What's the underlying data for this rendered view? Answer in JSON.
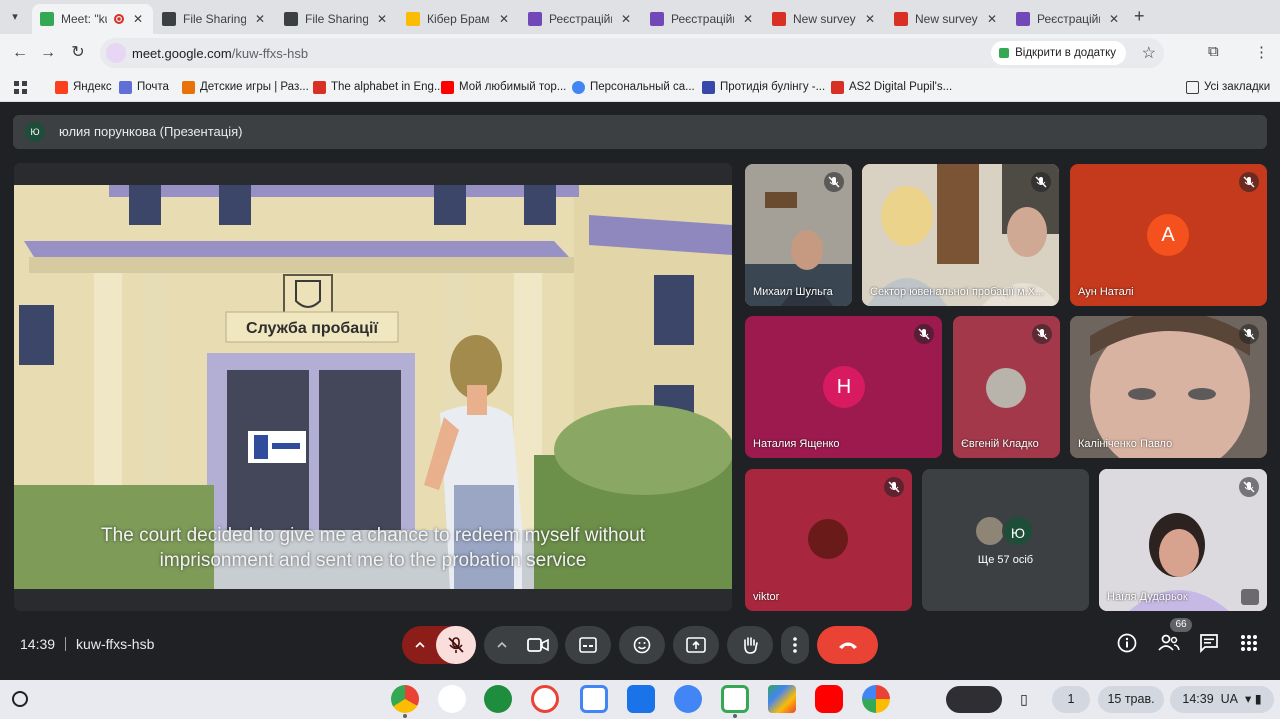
{
  "browser": {
    "tabs": [
      {
        "label": "Meet: \"ku",
        "favicon_color": "#34a853",
        "active": true
      },
      {
        "label": "File Sharing a",
        "favicon_color": "#3c4043"
      },
      {
        "label": "File Sharing a",
        "favicon_color": "#3c4043"
      },
      {
        "label": "Кібер Брама",
        "favicon_color": "#fbbc04"
      },
      {
        "label": "Реєстраційна",
        "favicon_color": "#7248b9"
      },
      {
        "label": "Реєстраційна",
        "favicon_color": "#7248b9"
      },
      {
        "label": "New survey -",
        "favicon_color": "#d93025"
      },
      {
        "label": "New survey -",
        "favicon_color": "#d93025"
      },
      {
        "label": "Реєстраційна",
        "favicon_color": "#7248b9"
      }
    ],
    "url_domain": "meet.google.com",
    "url_path": "/kuw-ffxs-hsb",
    "open_in_app_label": "Відкрити в додатку",
    "bookmarks": [
      {
        "label": "Яндекс",
        "color": "#fc3f1d"
      },
      {
        "label": "Почта",
        "color": "#5f6fd6"
      },
      {
        "label": "Детские игры | Раз...",
        "color": "#e8710a"
      },
      {
        "label": "The alphabet in Eng...",
        "color": "#d93025"
      },
      {
        "label": "Мой любимый тор...",
        "color": "#ff0000"
      },
      {
        "label": "Персональный са...",
        "color": "#4285f4"
      },
      {
        "label": "Протидія булінгу -...",
        "color": "#3949ab"
      },
      {
        "label": "AS2 Digital Pupil's...",
        "color": "#d93025"
      }
    ],
    "all_bookmarks_label": "Усі закладки"
  },
  "meet": {
    "presenter": {
      "avatar_letter": "Ю",
      "label": "юлия порункова (Презентація)"
    },
    "slide": {
      "sign_text": "Служба пробації",
      "subtitle_line1": "The court decided to give me a chance to redeem myself without",
      "subtitle_line2": "imprisonment and sent me to the probation service"
    },
    "participants": [
      {
        "name": "Михаил Шульга",
        "muted": true
      },
      {
        "name": "Сектор ювенальної пробації м.Х...",
        "muted": true
      },
      {
        "name": "Аун Наталі",
        "muted": true,
        "avatar_letter": "A",
        "avatar_color": "#f4511e",
        "tile_color": "#c5391d"
      },
      {
        "name": "Наталия Ященко",
        "muted": true,
        "avatar_letter": "Н",
        "avatar_color": "#d81b60",
        "tile_color": "#9c1a4e"
      },
      {
        "name": "Євгеній Кладко",
        "muted": true,
        "tile_color": "#a3384a"
      },
      {
        "name": "Калініченко Павло",
        "muted": true
      },
      {
        "name": "viktor",
        "muted": true,
        "tile_color": "#a8273e"
      },
      {
        "more_label": "Ще 57 осіб",
        "avatar_letter": "Ю"
      },
      {
        "name": "Наїля Дударьок",
        "muted": true
      }
    ],
    "controls": {
      "time": "14:39",
      "meeting_code": "kuw-ffxs-hsb",
      "participant_count": "66"
    }
  },
  "shelf": {
    "date": "15 трав.",
    "time": "14:39",
    "locale": "UA",
    "notification_count": "1"
  }
}
